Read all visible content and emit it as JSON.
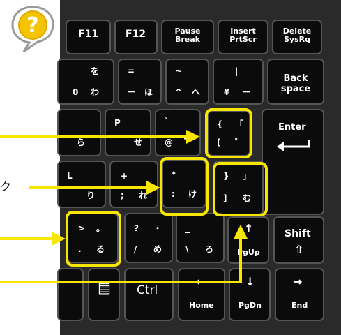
{
  "colors": {
    "highlight": "#f6e600",
    "keycap": "#0b0b0b",
    "keyboard": "#2a2a2a",
    "text": "#ffffff"
  },
  "help_icon": {
    "icon": "question-bubble-icon",
    "glyph": "?"
  },
  "side_label": "ク",
  "keys": {
    "f11": "F11",
    "f12": "F12",
    "pause_1": "Pause",
    "pause_2": "Break",
    "insert_1": "Insert",
    "insert_2": "PrtScr",
    "delete_1": "Delete",
    "delete_2": "SysRq",
    "k0_top": "0",
    "k0_kana": "わ",
    "minus_top": "=",
    "minus_bottom": "ー",
    "minus_kana": "ほ",
    "minus_kana_top": "を",
    "caret_top": "~",
    "caret_bottom": "^",
    "caret_kana": "へ",
    "yen_top": "|",
    "yen_bottom": "¥",
    "yen_kana": "ー",
    "back_1": "Back",
    "back_2": "space",
    "o_kana": "ら",
    "p_top": "P",
    "p_kana": "せ",
    "at_top": "`",
    "at_bottom": "@",
    "at_kana": "゛",
    "bracket_open_top": "{",
    "bracket_open_bottom": "[",
    "bracket_open_kana_top": "「",
    "bracket_open_kana": "゜",
    "enter": "Enter",
    "l_top": "L",
    "l_kana": "り",
    "plus_top": "+",
    "plus_bottom": ";",
    "plus_kana": "れ",
    "colon_top": "*",
    "colon_bottom": ":",
    "colon_kana": "け",
    "bracket_close_top": "}",
    "bracket_close_bottom": "]",
    "bracket_close_kana_top": "」",
    "bracket_close_kana": "む",
    "period_top": ">",
    "period_bottom": ".",
    "period_kana_top": "。",
    "period_kana": "る",
    "slash_top": "?",
    "slash_bottom": "/",
    "slash_kana_top": "・",
    "slash_kana": "め",
    "backslash_top": "_",
    "backslash_bottom": "\\",
    "backslash_kana": "ろ",
    "pgup_arrow": "↑",
    "pgup": "PgUp",
    "shift": "Shift",
    "shift_arrow": "⇧",
    "menu_icon": "▤",
    "ctrl": "Ctrl",
    "home_arrow": "←",
    "home": "Home",
    "pgdn_arrow": "↓",
    "pgdn": "PgDn",
    "end_arrow": "→",
    "end": "End"
  }
}
